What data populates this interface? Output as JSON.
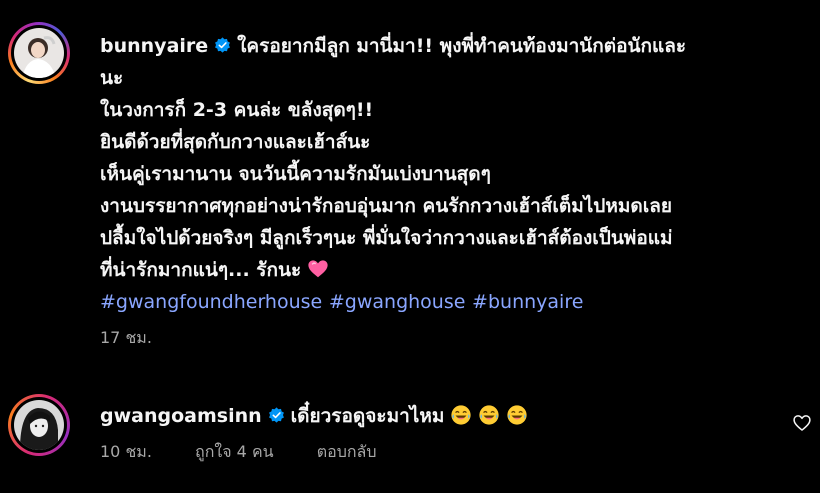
{
  "comments": [
    {
      "username": "bunnyaire",
      "lines": [
        "ใครอยากมีลูก มานี่มา!! พุงพี่ทำคนท้องมานักต่อนักและ",
        "นะ",
        "ในวงการก็ 2-3 คนล่ะ ขลังสุดๆ!!",
        "ยินดีด้วยที่สุดกับกวางและเฮ้าส์นะ",
        "เห็นคู่เรามานาน จนวันนี้ความรักมันเบ่งบานสุดๆ",
        "งานบรรยากาศทุกอย่างน่ารักอบอุ่นมาก คนรักกวางเฮ้าส์เต็มไปหมดเลย",
        "ปลื้มใจไปด้วยจริงๆ มีลูกเร็วๆนะ พี่มั่นใจว่ากวางและเฮ้าส์ต้องเป็นพ่อแม่",
        "ที่น่ารักมากแน่ๆ... รักนะ"
      ],
      "hashtags": [
        "#gwangfoundherhouse",
        "#gwanghouse",
        "#bunnyaire"
      ],
      "time": "17 ชม."
    },
    {
      "username": "gwangoamsinn",
      "text": "เดี๋ยวรอดูจะมาไหม",
      "time": "10 ชม.",
      "likes": "ถูกใจ 4 คน",
      "reply": "ตอบกลับ"
    }
  ],
  "colors": {
    "background": "#000000",
    "text": "#f5f5f5",
    "muted": "#a8a8a8",
    "hashtag": "#8aa6ff",
    "verified": "#0095f6",
    "heart_emoji": "#ff5fa2"
  },
  "icons": {
    "verified": "verified-badge-icon",
    "heart_emoji": "pink-heart-emoji",
    "laugh_emoji": "laughing-tears-emoji",
    "like": "heart-outline-icon"
  }
}
